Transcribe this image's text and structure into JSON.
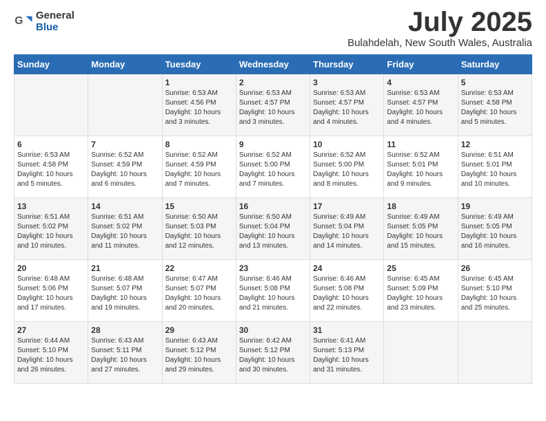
{
  "header": {
    "logo": {
      "general": "General",
      "blue": "Blue"
    },
    "title": "July 2025",
    "location": "Bulahdelah, New South Wales, Australia"
  },
  "days_of_week": [
    "Sunday",
    "Monday",
    "Tuesday",
    "Wednesday",
    "Thursday",
    "Friday",
    "Saturday"
  ],
  "weeks": [
    [
      {
        "day": "",
        "info": ""
      },
      {
        "day": "",
        "info": ""
      },
      {
        "day": "1",
        "info": "Sunrise: 6:53 AM\nSunset: 4:56 PM\nDaylight: 10 hours\nand 3 minutes."
      },
      {
        "day": "2",
        "info": "Sunrise: 6:53 AM\nSunset: 4:57 PM\nDaylight: 10 hours\nand 3 minutes."
      },
      {
        "day": "3",
        "info": "Sunrise: 6:53 AM\nSunset: 4:57 PM\nDaylight: 10 hours\nand 4 minutes."
      },
      {
        "day": "4",
        "info": "Sunrise: 6:53 AM\nSunset: 4:57 PM\nDaylight: 10 hours\nand 4 minutes."
      },
      {
        "day": "5",
        "info": "Sunrise: 6:53 AM\nSunset: 4:58 PM\nDaylight: 10 hours\nand 5 minutes."
      }
    ],
    [
      {
        "day": "6",
        "info": "Sunrise: 6:53 AM\nSunset: 4:58 PM\nDaylight: 10 hours\nand 5 minutes."
      },
      {
        "day": "7",
        "info": "Sunrise: 6:52 AM\nSunset: 4:59 PM\nDaylight: 10 hours\nand 6 minutes."
      },
      {
        "day": "8",
        "info": "Sunrise: 6:52 AM\nSunset: 4:59 PM\nDaylight: 10 hours\nand 7 minutes."
      },
      {
        "day": "9",
        "info": "Sunrise: 6:52 AM\nSunset: 5:00 PM\nDaylight: 10 hours\nand 7 minutes."
      },
      {
        "day": "10",
        "info": "Sunrise: 6:52 AM\nSunset: 5:00 PM\nDaylight: 10 hours\nand 8 minutes."
      },
      {
        "day": "11",
        "info": "Sunrise: 6:52 AM\nSunset: 5:01 PM\nDaylight: 10 hours\nand 9 minutes."
      },
      {
        "day": "12",
        "info": "Sunrise: 6:51 AM\nSunset: 5:01 PM\nDaylight: 10 hours\nand 10 minutes."
      }
    ],
    [
      {
        "day": "13",
        "info": "Sunrise: 6:51 AM\nSunset: 5:02 PM\nDaylight: 10 hours\nand 10 minutes."
      },
      {
        "day": "14",
        "info": "Sunrise: 6:51 AM\nSunset: 5:02 PM\nDaylight: 10 hours\nand 11 minutes."
      },
      {
        "day": "15",
        "info": "Sunrise: 6:50 AM\nSunset: 5:03 PM\nDaylight: 10 hours\nand 12 minutes."
      },
      {
        "day": "16",
        "info": "Sunrise: 6:50 AM\nSunset: 5:04 PM\nDaylight: 10 hours\nand 13 minutes."
      },
      {
        "day": "17",
        "info": "Sunrise: 6:49 AM\nSunset: 5:04 PM\nDaylight: 10 hours\nand 14 minutes."
      },
      {
        "day": "18",
        "info": "Sunrise: 6:49 AM\nSunset: 5:05 PM\nDaylight: 10 hours\nand 15 minutes."
      },
      {
        "day": "19",
        "info": "Sunrise: 6:49 AM\nSunset: 5:05 PM\nDaylight: 10 hours\nand 16 minutes."
      }
    ],
    [
      {
        "day": "20",
        "info": "Sunrise: 6:48 AM\nSunset: 5:06 PM\nDaylight: 10 hours\nand 17 minutes."
      },
      {
        "day": "21",
        "info": "Sunrise: 6:48 AM\nSunset: 5:07 PM\nDaylight: 10 hours\nand 19 minutes."
      },
      {
        "day": "22",
        "info": "Sunrise: 6:47 AM\nSunset: 5:07 PM\nDaylight: 10 hours\nand 20 minutes."
      },
      {
        "day": "23",
        "info": "Sunrise: 6:46 AM\nSunset: 5:08 PM\nDaylight: 10 hours\nand 21 minutes."
      },
      {
        "day": "24",
        "info": "Sunrise: 6:46 AM\nSunset: 5:08 PM\nDaylight: 10 hours\nand 22 minutes."
      },
      {
        "day": "25",
        "info": "Sunrise: 6:45 AM\nSunset: 5:09 PM\nDaylight: 10 hours\nand 23 minutes."
      },
      {
        "day": "26",
        "info": "Sunrise: 6:45 AM\nSunset: 5:10 PM\nDaylight: 10 hours\nand 25 minutes."
      }
    ],
    [
      {
        "day": "27",
        "info": "Sunrise: 6:44 AM\nSunset: 5:10 PM\nDaylight: 10 hours\nand 26 minutes."
      },
      {
        "day": "28",
        "info": "Sunrise: 6:43 AM\nSunset: 5:11 PM\nDaylight: 10 hours\nand 27 minutes."
      },
      {
        "day": "29",
        "info": "Sunrise: 6:43 AM\nSunset: 5:12 PM\nDaylight: 10 hours\nand 29 minutes."
      },
      {
        "day": "30",
        "info": "Sunrise: 6:42 AM\nSunset: 5:12 PM\nDaylight: 10 hours\nand 30 minutes."
      },
      {
        "day": "31",
        "info": "Sunrise: 6:41 AM\nSunset: 5:13 PM\nDaylight: 10 hours\nand 31 minutes."
      },
      {
        "day": "",
        "info": ""
      },
      {
        "day": "",
        "info": ""
      }
    ]
  ]
}
